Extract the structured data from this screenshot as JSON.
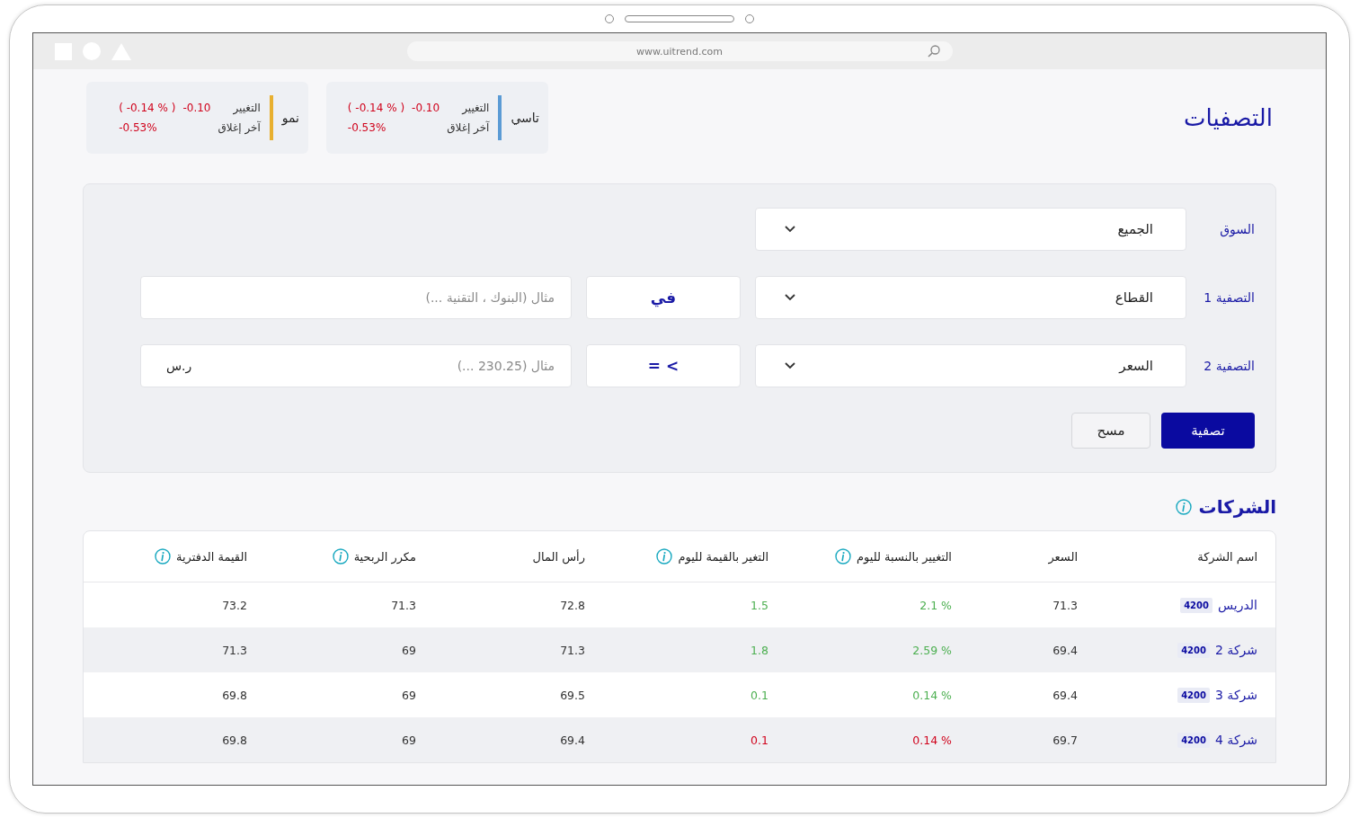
{
  "browser": {
    "url": "www.uitrend.com"
  },
  "page_title": "التصفيات",
  "indices": [
    {
      "name": "تاسي",
      "color": "#5b9bd5",
      "change_label": "التغيير",
      "change": "-0.10",
      "change_pct": "( -0.14 % )",
      "close_label": "آخر إغلاق",
      "close": "-0.53%"
    },
    {
      "name": "نمو",
      "color": "#e8b030",
      "change_label": "التغيير",
      "change": "-0.10",
      "change_pct": "( -0.14 % )",
      "close_label": "آخر إغلاق",
      "close": "-0.53%"
    }
  ],
  "filters": [
    {
      "kind": "select",
      "label": "السوق",
      "value": "الجميع"
    },
    {
      "kind": "condition",
      "label": "التصفية 1",
      "field": "القطاع",
      "operator": "في",
      "placeholder": "مثال (البنوك ، التقنية ...)"
    },
    {
      "kind": "condition",
      "label": "التصفية 2",
      "field": "السعر",
      "operator": "= <",
      "placeholder": "مثال (230.25 ...)",
      "unit": "ر.س"
    }
  ],
  "buttons": [
    {
      "label": "تصفية",
      "kind": "primary"
    },
    {
      "label": "مسح",
      "kind": "secondary"
    }
  ],
  "companies": {
    "title": "الشركات",
    "columns": [
      {
        "label": "اسم الشركة",
        "info": false
      },
      {
        "label": "السعر",
        "info": false
      },
      {
        "label": "التغيير بالنسبة لليوم",
        "info": true
      },
      {
        "label": "التغير بالقيمة لليوم",
        "info": true
      },
      {
        "label": "رأس المال",
        "info": false
      },
      {
        "label": "مكرر الربحية",
        "info": true
      },
      {
        "label": "القيمة الدفترية",
        "info": true
      }
    ],
    "rows": [
      {
        "name": "الدريس",
        "code": "4200",
        "price": "71.3",
        "color": "#4caf50",
        "change_pct": "2.1 %",
        "change_value": "1.5",
        "capital": "72.8",
        "pe": "71.3",
        "book_value": "73.2"
      },
      {
        "name": "شركة 2",
        "code": "4200",
        "price": "69.4",
        "color": "#4caf50",
        "change_pct": "2.59 %",
        "change_value": "1.8",
        "capital": "71.3",
        "pe": "69",
        "book_value": "71.3"
      },
      {
        "name": "شركة 3",
        "code": "4200",
        "price": "69.4",
        "color": "#4caf50",
        "change_pct": "0.14 %",
        "change_value": "0.1",
        "capital": "69.5",
        "pe": "69",
        "book_value": "69.8"
      },
      {
        "name": "شركة 4",
        "code": "4200",
        "price": "69.7",
        "color": "#d0021b",
        "change_pct": "0.14 %",
        "change_value": "0.1",
        "capital": "69.4",
        "pe": "69",
        "book_value": "69.8"
      }
    ]
  }
}
